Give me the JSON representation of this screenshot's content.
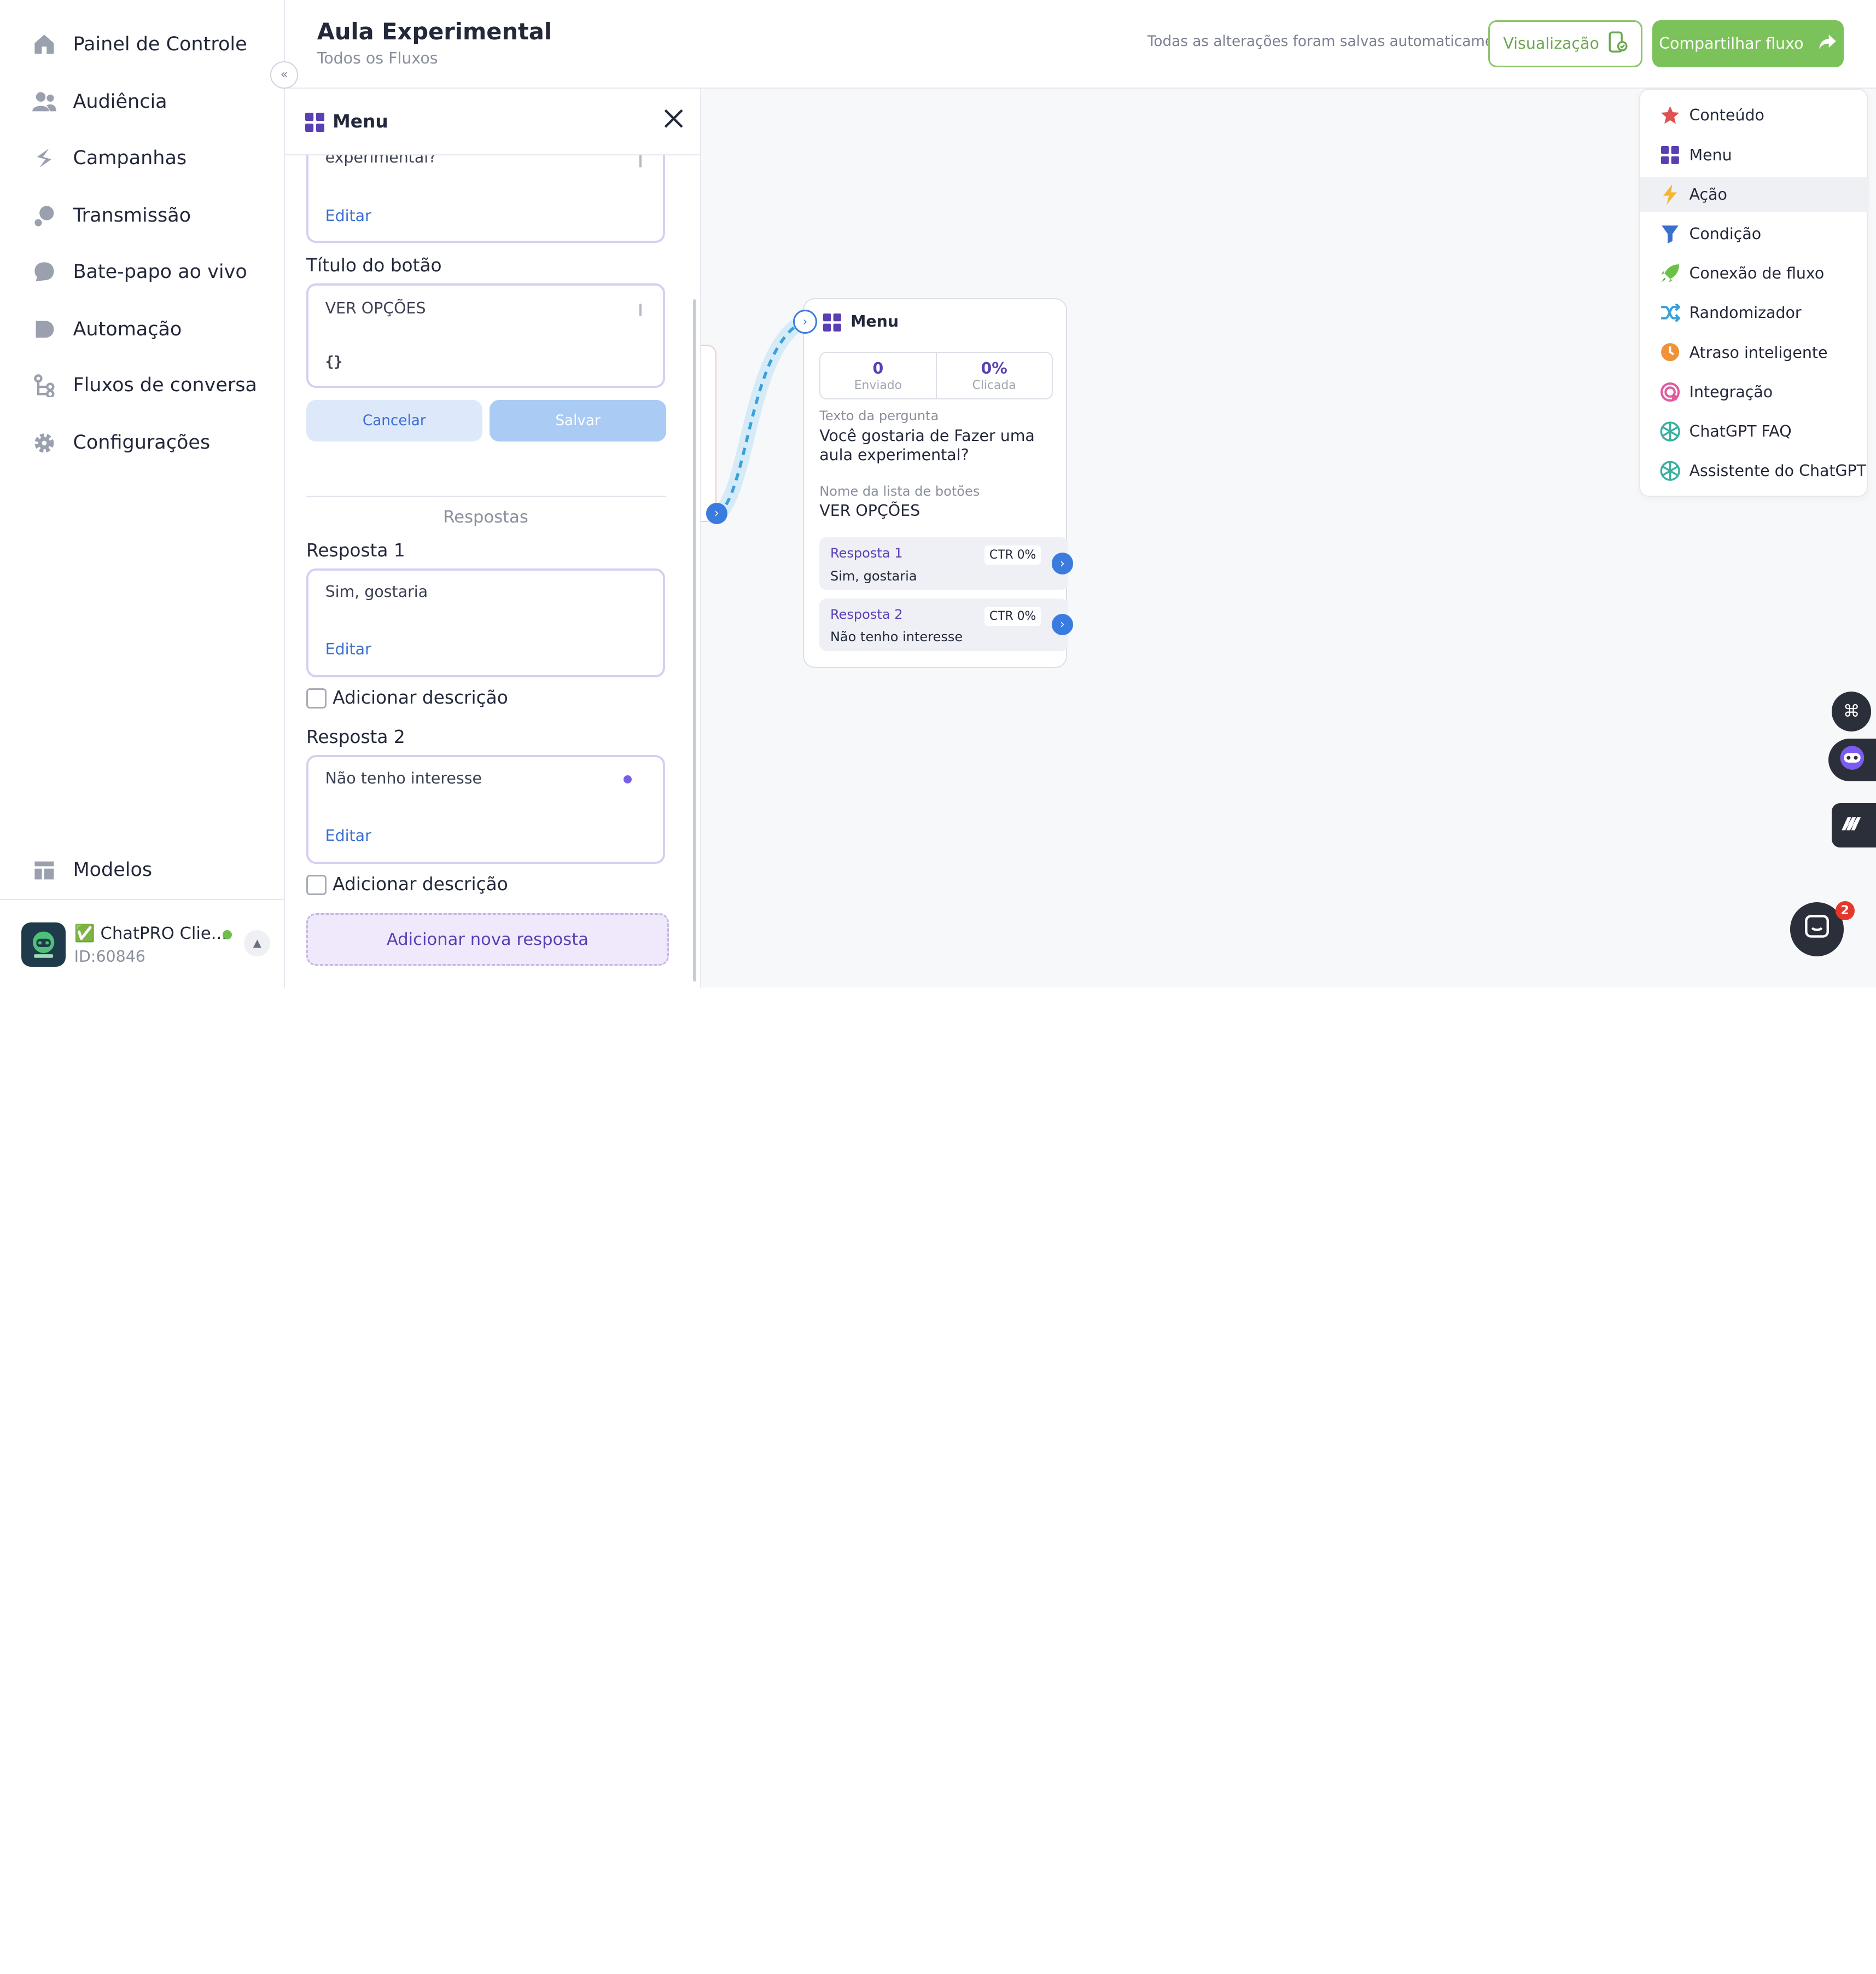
{
  "sidebar": {
    "items": [
      {
        "label": "Painel de Controle",
        "icon": "home-icon"
      },
      {
        "label": "Audiência",
        "icon": "users-icon"
      },
      {
        "label": "Campanhas",
        "icon": "campaign-icon"
      },
      {
        "label": "Transmissão",
        "icon": "broadcast-icon"
      },
      {
        "label": "Bate-papo ao vivo",
        "icon": "chat-icon"
      },
      {
        "label": "Automação",
        "icon": "automation-icon"
      },
      {
        "label": "Fluxos de conversa",
        "icon": "flow-icon"
      },
      {
        "label": "Configurações",
        "icon": "gear-icon"
      }
    ],
    "templates_label": "Modelos",
    "account": {
      "name": "✅ ChatPRO Clie...",
      "id": "ID:60846",
      "status_color": "#6cc04a"
    }
  },
  "header": {
    "title": "Aula Experimental",
    "breadcrumb": "Todos os Fluxos",
    "autosave": "Todas as alterações foram salvas automaticamente",
    "preview_label": "Visualização",
    "share_label": "Compartilhar fluxo"
  },
  "panel": {
    "title": "Menu",
    "question_tail": "experimental?",
    "edit_label": "Editar",
    "button_title_label": "Título do botão",
    "button_title_value": "VER OPÇÕES",
    "variable_glyph": "{}",
    "cancel_label": "Cancelar",
    "save_label": "Salvar",
    "responses_section": "Respostas",
    "responses": [
      {
        "label": "Resposta 1",
        "value": "Sim, gostaria",
        "edit": "Editar",
        "desc": "Adicionar descrição"
      },
      {
        "label": "Resposta 2",
        "value": "Não tenho interesse",
        "edit": "Editar",
        "desc": "Adicionar descrição"
      }
    ],
    "add_response_label": "Adicionar nova resposta"
  },
  "node": {
    "title": "Menu",
    "stats": [
      {
        "value": "0",
        "label": "Enviado"
      },
      {
        "value": "0%",
        "label": "Clicada"
      }
    ],
    "question_label": "Texto da pergunta",
    "question_value": "Você gostaria de Fazer uma aula experimental?",
    "list_label": "Nome da lista de botões",
    "list_value": "VER OPÇÕES",
    "responses": [
      {
        "name": "Resposta 1",
        "text": "Sim, gostaria",
        "ctr": "CTR 0%"
      },
      {
        "name": "Resposta 2",
        "text": "Não tenho interesse",
        "ctr": "CTR 0%"
      }
    ]
  },
  "blocks": [
    {
      "label": "Conteúdo",
      "icon": "star-icon",
      "color": "#e05252"
    },
    {
      "label": "Menu",
      "icon": "menu-grid-icon",
      "color": "#5a3fb4"
    },
    {
      "label": "Ação",
      "icon": "lightning-icon",
      "color": "#f2b632"
    },
    {
      "label": "Condição",
      "icon": "filter-icon",
      "color": "#3a6fcf"
    },
    {
      "label": "Conexão de fluxo",
      "icon": "rocket-icon",
      "color": "#6cc04a"
    },
    {
      "label": "Randomizador",
      "icon": "shuffle-icon",
      "color": "#3aa0d8"
    },
    {
      "label": "Atraso inteligente",
      "icon": "clock-icon",
      "color": "#f0923a"
    },
    {
      "label": "Integração",
      "icon": "integration-icon",
      "color": "#e05aa0"
    },
    {
      "label": "ChatGPT FAQ",
      "icon": "openai-icon",
      "color": "#3ab0a0"
    },
    {
      "label": "Assistente do ChatGPT",
      "icon": "openai-icon",
      "color": "#3ab0a0"
    }
  ],
  "widgets": {
    "chat_badge": "2"
  },
  "colors": {
    "accent_green": "#7cc25a",
    "accent_purple": "#5a3fb4",
    "accent_blue": "#3a7be0"
  }
}
